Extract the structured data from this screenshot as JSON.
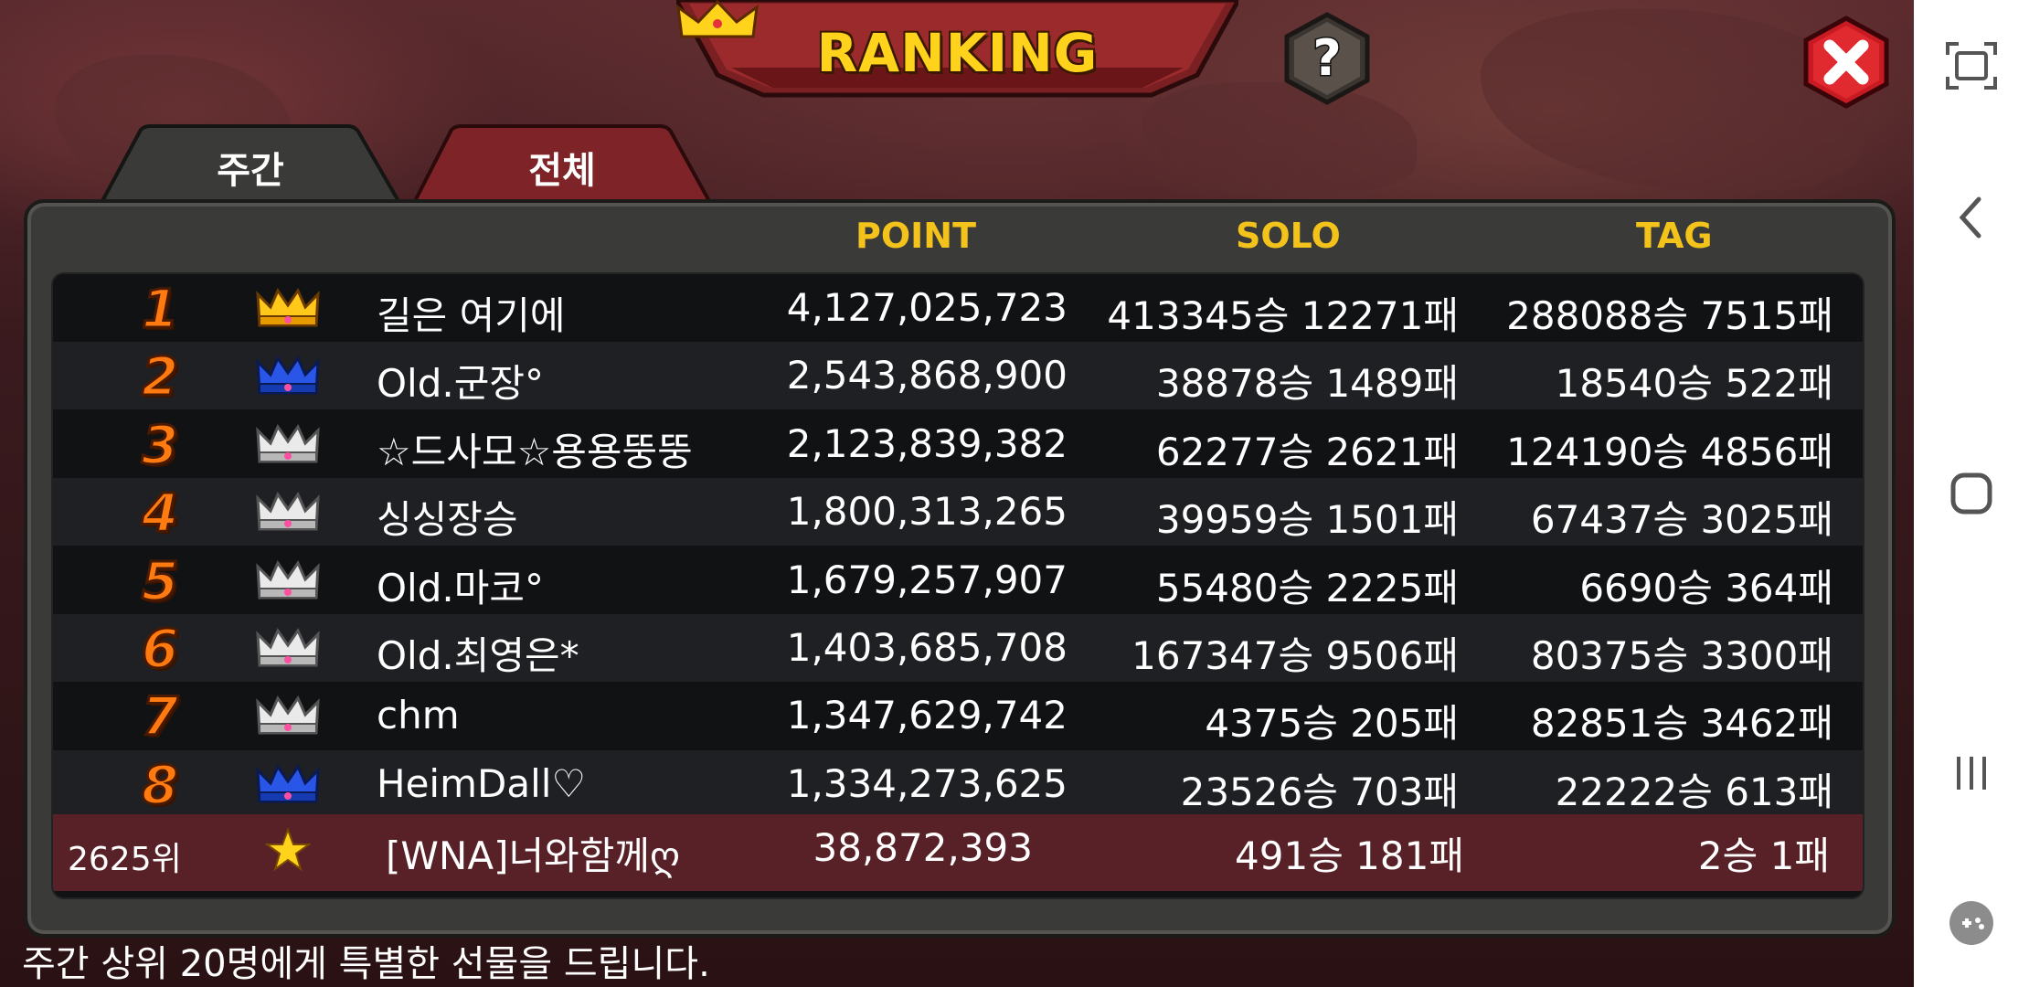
{
  "banner": {
    "title": "RANKING",
    "crown_icon": "crown-icon"
  },
  "buttons": {
    "help": "?",
    "close": "close-icon"
  },
  "tabs": [
    {
      "label": "주간",
      "active": true
    },
    {
      "label": "전체",
      "active": false
    }
  ],
  "columns": {
    "point": "POINT",
    "solo": "SOLO",
    "tag": "TAG"
  },
  "rows": [
    {
      "rank": "1",
      "crown": "gold",
      "name": "길은 여기에",
      "point": "4,127,025,723",
      "solo": "413345승 12271패",
      "tag": "288088승 7515패"
    },
    {
      "rank": "2",
      "crown": "blue",
      "name": "Old.군장°",
      "point": "2,543,868,900",
      "solo": "38878승 1489패",
      "tag": "18540승 522패"
    },
    {
      "rank": "3",
      "crown": "silver",
      "name": "☆드사모☆용용뚱뚱",
      "point": "2,123,839,382",
      "solo": "62277승 2621패",
      "tag": "124190승 4856패"
    },
    {
      "rank": "4",
      "crown": "silver",
      "name": "싱싱장승",
      "point": "1,800,313,265",
      "solo": "39959승 1501패",
      "tag": "67437승 3025패"
    },
    {
      "rank": "5",
      "crown": "silver",
      "name": "Old.마코°",
      "point": "1,679,257,907",
      "solo": "55480승 2225패",
      "tag": "6690승 364패"
    },
    {
      "rank": "6",
      "crown": "silver",
      "name": "Old.최영은*",
      "point": "1,403,685,708",
      "solo": "167347승 9506패",
      "tag": "80375승 3300패"
    },
    {
      "rank": "7",
      "crown": "silver",
      "name": "chm",
      "point": "1,347,629,742",
      "solo": "4375승 205패",
      "tag": "82851승 3462패"
    },
    {
      "rank": "8",
      "crown": "blue",
      "name": "HeimDall♡",
      "point": "1,334,273,625",
      "solo": "23526승 703패",
      "tag": "22222승 613패"
    }
  ],
  "my_rank": {
    "rank": "2625위",
    "icon": "star-icon",
    "name": "[WNA]너와함께ღ",
    "point": "38,872,393",
    "solo": "491승 181패",
    "tag": "2승 1패"
  },
  "footer": "주간 상위 20명에게 특별한 선물을 드립니다.",
  "navbar": [
    "screenshot-icon",
    "back-icon",
    "home-icon",
    "recents-icon",
    "game-tools-icon"
  ],
  "colors": {
    "gold": "#ffd21c",
    "header_yellow": "#f3c21b",
    "rank_orange": "#ff7a10",
    "my_row": "#572127"
  }
}
